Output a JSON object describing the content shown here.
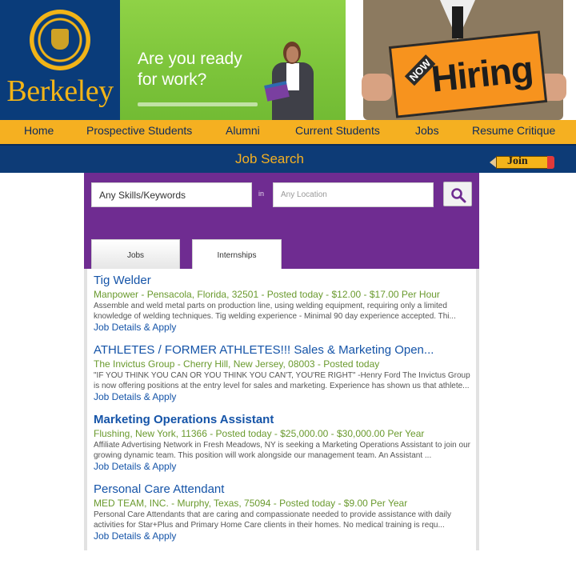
{
  "banner": {
    "logo_text": "Berkeley",
    "ready_line1": "Are you ready",
    "ready_line2": "for work?",
    "hiring_sign_small": "NOW",
    "hiring_sign_word": "Hiring"
  },
  "nav": {
    "items": [
      "Home",
      "Prospective Students",
      "Alumni",
      "Current Students",
      "Jobs",
      "Resume Critique"
    ]
  },
  "jobbar": {
    "title": "Job Search",
    "join_label": "Join"
  },
  "search": {
    "keywords_placeholder": "Any Skills/Keywords",
    "in_label": "in",
    "location_placeholder": "Any Location",
    "search_icon": "magnifier-icon",
    "tabs": [
      "Jobs",
      "Internships"
    ]
  },
  "results": [
    {
      "title": "Tig Welder",
      "meta": "Manpower - Pensacola, Florida, 32501 - Posted today - $12.00 - $17.00 Per Hour",
      "desc": "Assemble and weld metal parts on production line, using welding equipment, requiring only a limited knowledge of welding techniques. Tig welding experience - Minimal 90 day experience accepted. Thi...",
      "link": "Job Details & Apply"
    },
    {
      "title": "ATHLETES / FORMER ATHLETES!!! Sales & Marketing Open...",
      "meta": "The Invictus Group - Cherry Hill, New Jersey, 08003 - Posted today",
      "desc": "\"IF YOU THINK YOU CAN OR YOU THINK YOU CAN'T, YOU'RE RIGHT\" -Henry Ford The Invictus Group is now offering positions at the entry level for sales and marketing. Experience has shown us that athlete...",
      "link": "Job Details & Apply"
    },
    {
      "title": "Marketing Operations Assistant",
      "meta": "Flushing, New York, 11366 - Posted today - $25,000.00 - $30,000.00 Per Year",
      "desc": "Affiliate Advertising Network in Fresh Meadows, NY is seeking a Marketing Operations Assistant to join our growing dynamic team. This position will work alongside our management team. An Assistant ...",
      "link": "Job Details & Apply"
    },
    {
      "title": "Personal Care Attendant",
      "meta": "MED TEAM, INC. - Murphy, Texas, 75094 - Posted today - $9.00 Per Year",
      "desc": "Personal Care Attendants that are caring and compassionate needed to provide assistance with daily activities for Star+Plus and Primary Home Care clients in their homes. No medical training is requ...",
      "link": "Job Details & Apply"
    }
  ]
}
